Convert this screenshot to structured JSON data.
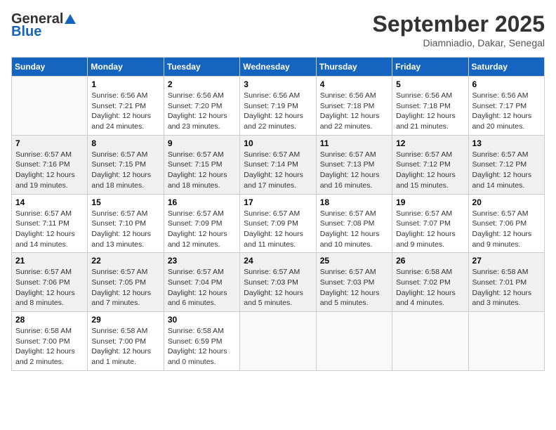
{
  "header": {
    "logo_general": "General",
    "logo_blue": "Blue",
    "month": "September 2025",
    "location": "Diamniadio, Dakar, Senegal"
  },
  "days_of_week": [
    "Sunday",
    "Monday",
    "Tuesday",
    "Wednesday",
    "Thursday",
    "Friday",
    "Saturday"
  ],
  "weeks": [
    [
      {
        "day": "",
        "info": ""
      },
      {
        "day": "1",
        "info": "Sunrise: 6:56 AM\nSunset: 7:21 PM\nDaylight: 12 hours\nand 24 minutes."
      },
      {
        "day": "2",
        "info": "Sunrise: 6:56 AM\nSunset: 7:20 PM\nDaylight: 12 hours\nand 23 minutes."
      },
      {
        "day": "3",
        "info": "Sunrise: 6:56 AM\nSunset: 7:19 PM\nDaylight: 12 hours\nand 22 minutes."
      },
      {
        "day": "4",
        "info": "Sunrise: 6:56 AM\nSunset: 7:18 PM\nDaylight: 12 hours\nand 22 minutes."
      },
      {
        "day": "5",
        "info": "Sunrise: 6:56 AM\nSunset: 7:18 PM\nDaylight: 12 hours\nand 21 minutes."
      },
      {
        "day": "6",
        "info": "Sunrise: 6:56 AM\nSunset: 7:17 PM\nDaylight: 12 hours\nand 20 minutes."
      }
    ],
    [
      {
        "day": "7",
        "info": "Sunrise: 6:57 AM\nSunset: 7:16 PM\nDaylight: 12 hours\nand 19 minutes."
      },
      {
        "day": "8",
        "info": "Sunrise: 6:57 AM\nSunset: 7:15 PM\nDaylight: 12 hours\nand 18 minutes."
      },
      {
        "day": "9",
        "info": "Sunrise: 6:57 AM\nSunset: 7:15 PM\nDaylight: 12 hours\nand 18 minutes."
      },
      {
        "day": "10",
        "info": "Sunrise: 6:57 AM\nSunset: 7:14 PM\nDaylight: 12 hours\nand 17 minutes."
      },
      {
        "day": "11",
        "info": "Sunrise: 6:57 AM\nSunset: 7:13 PM\nDaylight: 12 hours\nand 16 minutes."
      },
      {
        "day": "12",
        "info": "Sunrise: 6:57 AM\nSunset: 7:12 PM\nDaylight: 12 hours\nand 15 minutes."
      },
      {
        "day": "13",
        "info": "Sunrise: 6:57 AM\nSunset: 7:12 PM\nDaylight: 12 hours\nand 14 minutes."
      }
    ],
    [
      {
        "day": "14",
        "info": "Sunrise: 6:57 AM\nSunset: 7:11 PM\nDaylight: 12 hours\nand 14 minutes."
      },
      {
        "day": "15",
        "info": "Sunrise: 6:57 AM\nSunset: 7:10 PM\nDaylight: 12 hours\nand 13 minutes."
      },
      {
        "day": "16",
        "info": "Sunrise: 6:57 AM\nSunset: 7:09 PM\nDaylight: 12 hours\nand 12 minutes."
      },
      {
        "day": "17",
        "info": "Sunrise: 6:57 AM\nSunset: 7:09 PM\nDaylight: 12 hours\nand 11 minutes."
      },
      {
        "day": "18",
        "info": "Sunrise: 6:57 AM\nSunset: 7:08 PM\nDaylight: 12 hours\nand 10 minutes."
      },
      {
        "day": "19",
        "info": "Sunrise: 6:57 AM\nSunset: 7:07 PM\nDaylight: 12 hours\nand 9 minutes."
      },
      {
        "day": "20",
        "info": "Sunrise: 6:57 AM\nSunset: 7:06 PM\nDaylight: 12 hours\nand 9 minutes."
      }
    ],
    [
      {
        "day": "21",
        "info": "Sunrise: 6:57 AM\nSunset: 7:06 PM\nDaylight: 12 hours\nand 8 minutes."
      },
      {
        "day": "22",
        "info": "Sunrise: 6:57 AM\nSunset: 7:05 PM\nDaylight: 12 hours\nand 7 minutes."
      },
      {
        "day": "23",
        "info": "Sunrise: 6:57 AM\nSunset: 7:04 PM\nDaylight: 12 hours\nand 6 minutes."
      },
      {
        "day": "24",
        "info": "Sunrise: 6:57 AM\nSunset: 7:03 PM\nDaylight: 12 hours\nand 5 minutes."
      },
      {
        "day": "25",
        "info": "Sunrise: 6:57 AM\nSunset: 7:03 PM\nDaylight: 12 hours\nand 5 minutes."
      },
      {
        "day": "26",
        "info": "Sunrise: 6:58 AM\nSunset: 7:02 PM\nDaylight: 12 hours\nand 4 minutes."
      },
      {
        "day": "27",
        "info": "Sunrise: 6:58 AM\nSunset: 7:01 PM\nDaylight: 12 hours\nand 3 minutes."
      }
    ],
    [
      {
        "day": "28",
        "info": "Sunrise: 6:58 AM\nSunset: 7:00 PM\nDaylight: 12 hours\nand 2 minutes."
      },
      {
        "day": "29",
        "info": "Sunrise: 6:58 AM\nSunset: 7:00 PM\nDaylight: 12 hours\nand 1 minute."
      },
      {
        "day": "30",
        "info": "Sunrise: 6:58 AM\nSunset: 6:59 PM\nDaylight: 12 hours\nand 0 minutes."
      },
      {
        "day": "",
        "info": ""
      },
      {
        "day": "",
        "info": ""
      },
      {
        "day": "",
        "info": ""
      },
      {
        "day": "",
        "info": ""
      }
    ]
  ]
}
